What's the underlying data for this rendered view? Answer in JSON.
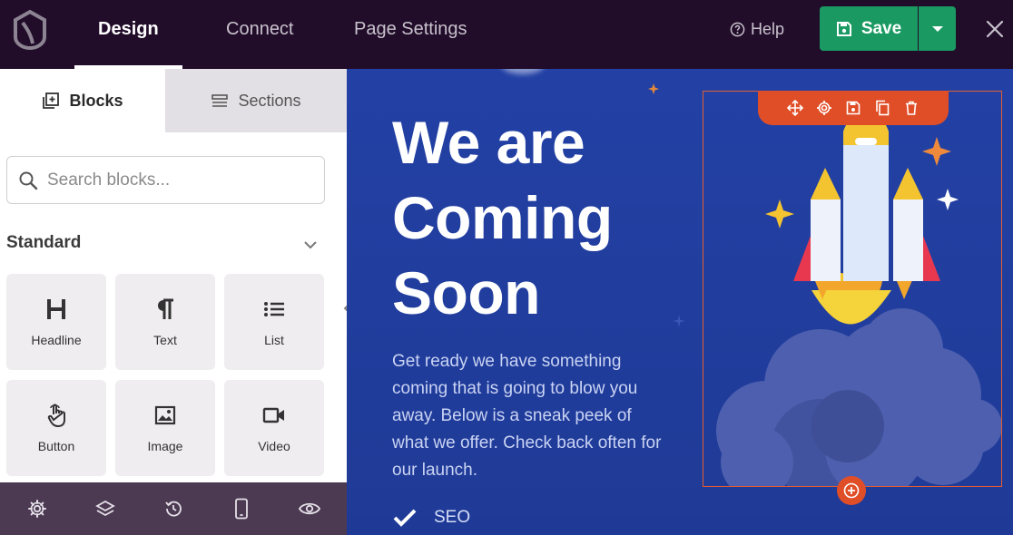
{
  "topbar": {
    "tabs": [
      {
        "label": "Design"
      },
      {
        "label": "Connect"
      },
      {
        "label": "Page Settings"
      }
    ],
    "help_label": "Help",
    "save_label": "Save"
  },
  "panel": {
    "tabs": [
      {
        "label": "Blocks",
        "icon": "blocks-icon"
      },
      {
        "label": "Sections",
        "icon": "sections-icon"
      }
    ],
    "search": {
      "placeholder": "Search blocks..."
    },
    "group_title": "Standard",
    "blocks": [
      {
        "label": "Headline",
        "icon": "headline-icon"
      },
      {
        "label": "Text",
        "icon": "paragraph-icon"
      },
      {
        "label": "List",
        "icon": "list-icon"
      },
      {
        "label": "Button",
        "icon": "pointer-hand-icon"
      },
      {
        "label": "Image",
        "icon": "image-icon"
      },
      {
        "label": "Video",
        "icon": "video-icon"
      }
    ],
    "footer_icons": [
      "settings-icon",
      "layers-icon",
      "history-icon",
      "mobile-preview-icon",
      "preview-eye-icon"
    ]
  },
  "canvas": {
    "headline": [
      "We are",
      "Coming",
      "Soon"
    ],
    "body": "Get ready we have something coming that is going to blow you away. Below is a sneak peek of what we offer. Check back often for our launch.",
    "feature": "SEO",
    "toolbar_icons": [
      "move-icon",
      "settings-icon",
      "save-icon",
      "duplicate-icon",
      "delete-icon"
    ]
  },
  "colors": {
    "topbar_bg": "#210c2a",
    "save_green": "#1a9a62",
    "canvas_blue": "#2341a5",
    "selection_orange": "#e04e27",
    "footer_purple": "#4c3a53"
  }
}
